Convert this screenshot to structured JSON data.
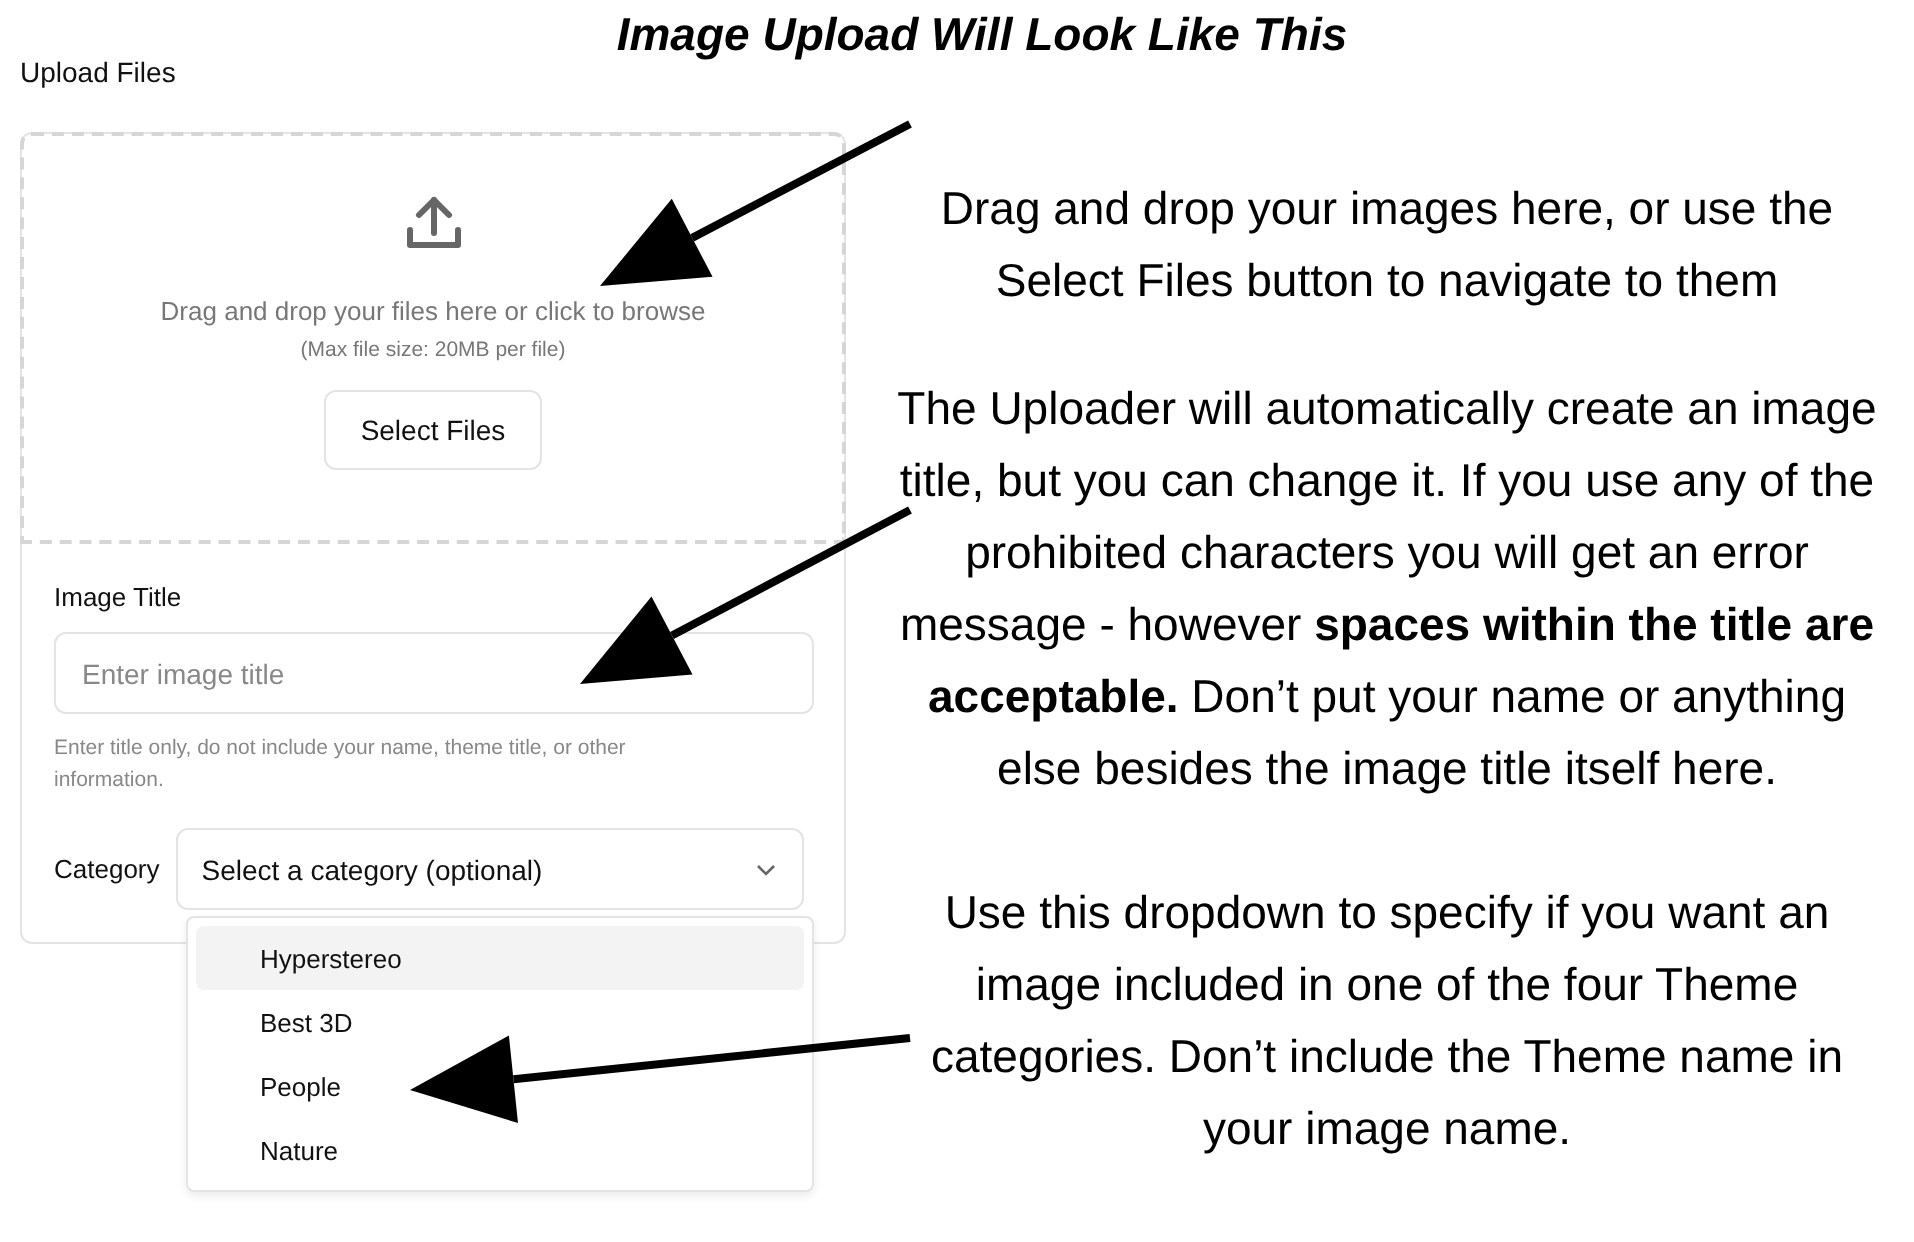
{
  "heading": "Image Upload Will Look Like This",
  "form": {
    "title": "Upload Files",
    "dropzone": {
      "instruction": "Drag and drop your files here or click to browse",
      "limit": "(Max file size: 20MB per file)",
      "button": "Select Files"
    },
    "image_title": {
      "label": "Image Title",
      "placeholder": "Enter image title",
      "hint": "Enter title only, do not include your name, theme title, or other information."
    },
    "category": {
      "label": "Category",
      "placeholder": "Select a category (optional)",
      "expanded": true,
      "options": [
        {
          "label": "Hyperstereo",
          "selected": true
        },
        {
          "label": "Best 3D",
          "selected": false
        },
        {
          "label": "People",
          "selected": false
        },
        {
          "label": "Nature",
          "selected": false
        }
      ]
    }
  },
  "annotations": [
    "Drag and drop your images here, or use the Select Files button to navigate to them",
    "The Uploader will automatically create an image title, but you can change it. If you use any of the prohibited characters you will get an error message - however **spaces within the title are acceptable.** Don’t put your name or anything else besides the image title itself here.",
    "Use this dropdown to specify if you want an image included in one of the four Theme categories. Don’t include the Theme name in your image name."
  ]
}
